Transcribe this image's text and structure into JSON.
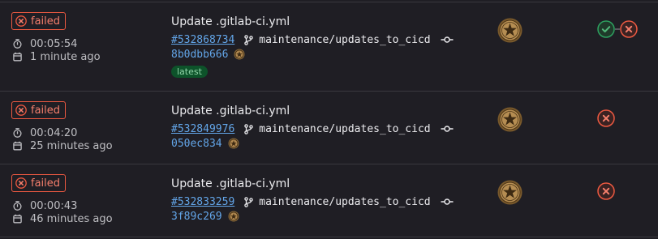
{
  "pipelines": [
    {
      "status": "failed",
      "duration": "00:05:54",
      "finished": "1 minute ago",
      "title": "Update .gitlab-ci.yml",
      "pipeline_id": "#532868734",
      "branch": "maintenance/updates_to_cicd",
      "commit_sha": "8b0dbb666",
      "badge": "latest",
      "stages": [
        "success",
        "failed"
      ]
    },
    {
      "status": "failed",
      "duration": "00:04:20",
      "finished": "25 minutes ago",
      "title": "Update .gitlab-ci.yml",
      "pipeline_id": "#532849976",
      "branch": "maintenance/updates_to_cicd",
      "commit_sha": "050ec834",
      "stages": [
        "failed"
      ]
    },
    {
      "status": "failed",
      "duration": "00:00:43",
      "finished": "46 minutes ago",
      "title": "Update .gitlab-ci.yml",
      "pipeline_id": "#532833259",
      "branch": "maintenance/updates_to_cicd",
      "commit_sha": "3f89c269",
      "stages": [
        "failed"
      ]
    }
  ],
  "colors": {
    "background": "#1f1e24",
    "failed": "#ec5941",
    "success": "#2da160",
    "link": "#63a6e9",
    "latest_badge_bg": "#0d532a"
  },
  "icons": [
    "status-failed-icon",
    "clock-icon",
    "calendar-icon",
    "branch-icon",
    "commit-icon",
    "user-avatar",
    "stage-success-icon",
    "stage-failed-icon"
  ]
}
